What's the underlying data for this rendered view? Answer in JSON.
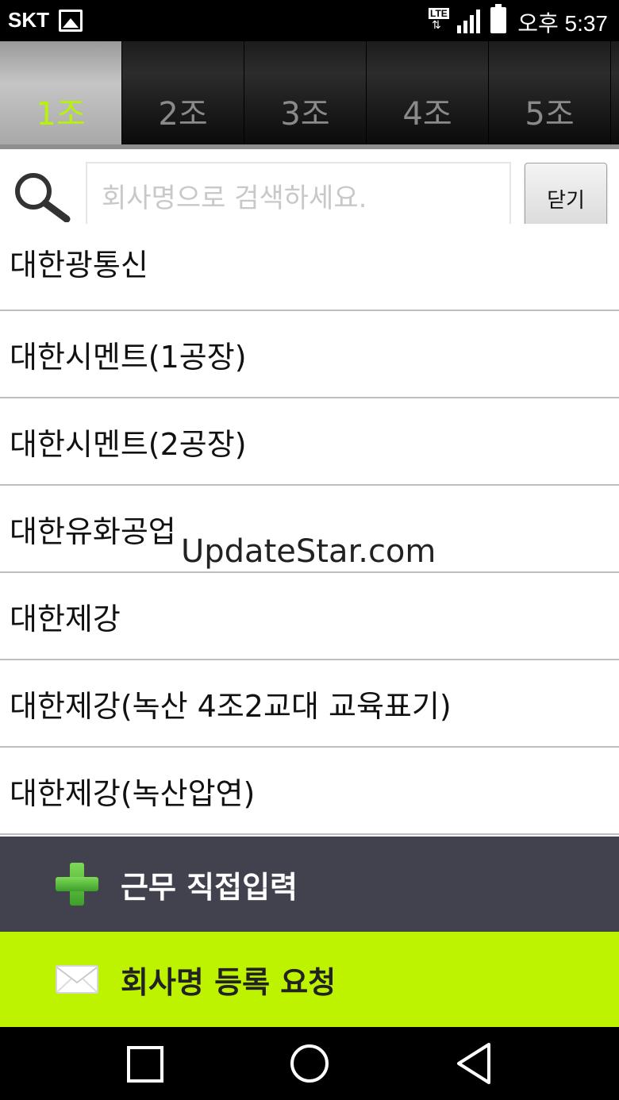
{
  "status_bar": {
    "carrier": "SKT",
    "network": "LTE",
    "time": "오후 5:37"
  },
  "tabs": [
    {
      "label": "1조",
      "active": true
    },
    {
      "label": "2조",
      "active": false
    },
    {
      "label": "3조",
      "active": false
    },
    {
      "label": "4조",
      "active": false
    },
    {
      "label": "5조",
      "active": false
    }
  ],
  "search": {
    "value": "",
    "placeholder": "회사명으로 검색하세요.",
    "close_label": "닫기"
  },
  "companies": [
    "대한광통신",
    "대한시멘트(1공장)",
    "대한시멘트(2공장)",
    "대한유화공업",
    "대한제강",
    "대한제강(녹산 4조2교대 교육표기)",
    "대한제강(녹산압연)"
  ],
  "watermark": "UpdateStar.com",
  "actions": {
    "direct_input_label": "근무 직접입력",
    "register_request_label": "회사명 등록 요청",
    "direct_input_icon": "plus-icon",
    "register_request_icon": "mail-icon"
  },
  "colors": {
    "active_tab_text": "#b8f20a",
    "direct_input_bg": "#42424f",
    "register_request_bg": "#bef300"
  }
}
